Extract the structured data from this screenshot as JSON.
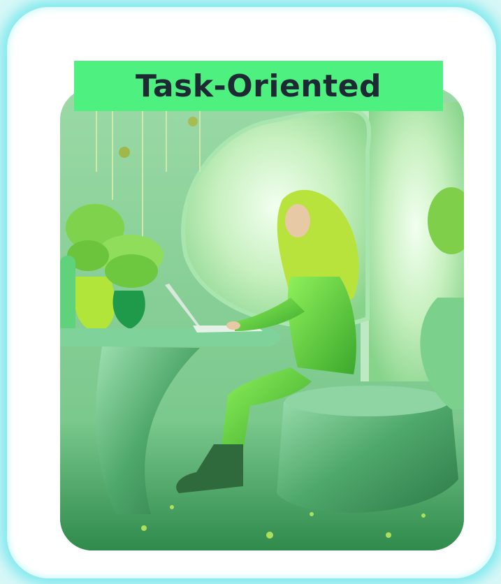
{
  "badge": {
    "title": "Task-Oriented"
  },
  "scene": {
    "description_icon": "woman-working-on-laptop-illustration",
    "colors": {
      "accent": "#4ef07f",
      "glow": "#7fe9ee",
      "wall": "#7fcf8e",
      "floor": "#3f9a58",
      "outfit": "#5fd23c",
      "furniture": "#4fae6c"
    }
  }
}
